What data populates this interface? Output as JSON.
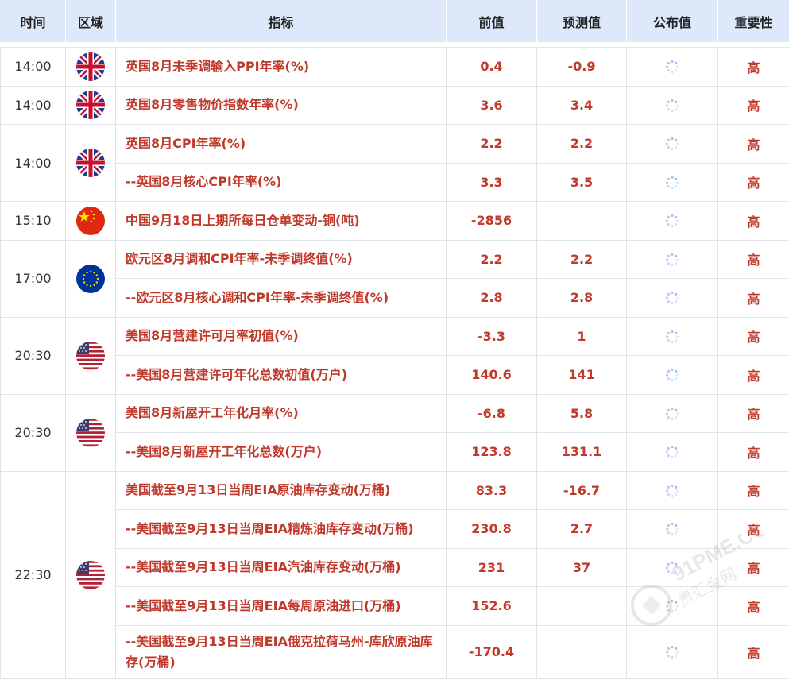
{
  "header": {
    "time": "时间",
    "region": "区域",
    "indicator": "指标",
    "previous": "前值",
    "forecast": "预测值",
    "published": "公布值",
    "importance": "重要性"
  },
  "groups": [
    {
      "time": "14:00",
      "flag": "uk-flag-icon",
      "rows": [
        {
          "indicator": "英国8月未季调输入PPI年率(%)",
          "previous": "0.4",
          "forecast": "-0.9",
          "importance": "高"
        }
      ]
    },
    {
      "time": "14:00",
      "flag": "uk-flag-icon",
      "rows": [
        {
          "indicator": "英国8月零售物价指数年率(%)",
          "previous": "3.6",
          "forecast": "3.4",
          "importance": "高"
        }
      ]
    },
    {
      "time": "14:00",
      "flag": "uk-flag-icon",
      "rows": [
        {
          "indicator": "英国8月CPI年率(%)",
          "previous": "2.2",
          "forecast": "2.2",
          "importance": "高"
        },
        {
          "indicator": "--英国8月核心CPI年率(%)",
          "previous": "3.3",
          "forecast": "3.5",
          "importance": "高"
        }
      ]
    },
    {
      "time": "15:10",
      "flag": "china-flag-icon",
      "rows": [
        {
          "indicator": "中国9月18日上期所每日仓单变动-铜(吨)",
          "previous": "-2856",
          "forecast": "",
          "importance": "高"
        }
      ]
    },
    {
      "time": "17:00",
      "flag": "eu-flag-icon",
      "rows": [
        {
          "indicator": "欧元区8月调和CPI年率-未季调终值(%)",
          "previous": "2.2",
          "forecast": "2.2",
          "importance": "高"
        },
        {
          "indicator": "--欧元区8月核心调和CPI年率-未季调终值(%)",
          "previous": "2.8",
          "forecast": "2.8",
          "importance": "高"
        }
      ]
    },
    {
      "time": "20:30",
      "flag": "us-flag-icon",
      "rows": [
        {
          "indicator": "美国8月营建许可月率初值(%)",
          "previous": "-3.3",
          "forecast": "1",
          "importance": "高"
        },
        {
          "indicator": "--美国8月营建许可年化总数初值(万户)",
          "previous": "140.6",
          "forecast": "141",
          "importance": "高"
        }
      ]
    },
    {
      "time": "20:30",
      "flag": "us-flag-icon",
      "rows": [
        {
          "indicator": "美国8月新屋开工年化月率(%)",
          "previous": "-6.8",
          "forecast": "5.8",
          "importance": "高"
        },
        {
          "indicator": "--美国8月新屋开工年化总数(万户)",
          "previous": "123.8",
          "forecast": "131.1",
          "importance": "高"
        }
      ]
    },
    {
      "time": "22:30",
      "flag": "us-flag-icon",
      "rows": [
        {
          "indicator": "美国截至9月13日当周EIA原油库存变动(万桶)",
          "previous": "83.3",
          "forecast": "-16.7",
          "importance": "高"
        },
        {
          "indicator": "--美国截至9月13日当周EIA精炼油库存变动(万桶)",
          "previous": "230.8",
          "forecast": "2.7",
          "importance": "高"
        },
        {
          "indicator": "--美国截至9月13日当周EIA汽油库存变动(万桶)",
          "previous": "231",
          "forecast": "37",
          "importance": "高"
        },
        {
          "indicator": "--美国截至9月13日当周EIA每周原油进口(万桶)",
          "previous": "152.6",
          "forecast": "",
          "importance": "高"
        },
        {
          "indicator": "--美国截至9月13日当周EIA俄克拉荷马州-库欣原油库存(万桶)",
          "previous": "-170.4",
          "forecast": "",
          "importance": "高",
          "tall": true
        }
      ]
    }
  ],
  "watermark": {
    "text1": "91PME.COM",
    "text2": "贵汇金网",
    "icon": "watermark-logo-icon"
  },
  "colors": {
    "header_bg": "#dde9fb",
    "value_red": "#c0392b",
    "border": "#dfe3ea",
    "accent": "#f39a3d"
  }
}
